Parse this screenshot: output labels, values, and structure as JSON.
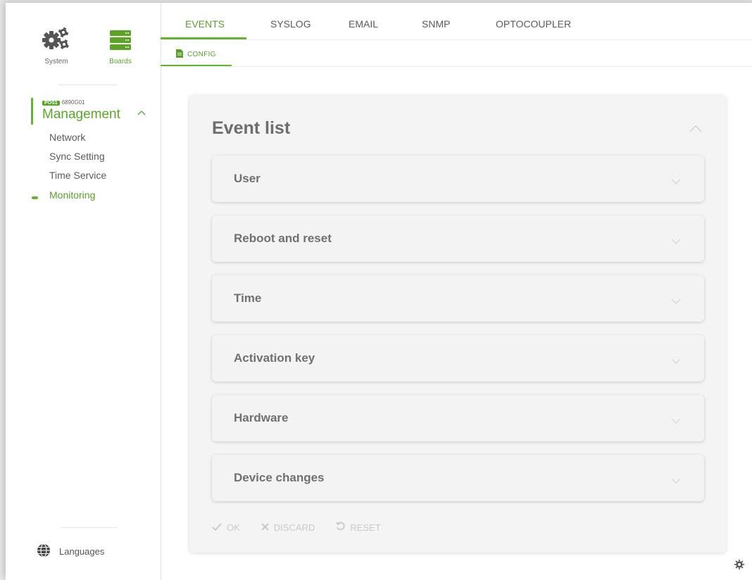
{
  "sidebar": {
    "top_icons": [
      {
        "label": "System",
        "icon": "gears-icon"
      },
      {
        "label": "Boards",
        "icon": "server-stack-icon"
      }
    ],
    "module": {
      "badge": "POS1",
      "model": "6890G01",
      "title": "Management"
    },
    "nav": [
      {
        "label": "Network",
        "active": false
      },
      {
        "label": "Sync Setting",
        "active": false
      },
      {
        "label": "Time Service",
        "active": false
      },
      {
        "label": "Monitoring",
        "active": true
      }
    ],
    "languages_label": "Languages"
  },
  "tabs": [
    {
      "label": "EVENTS",
      "active": true
    },
    {
      "label": "SYSLOG",
      "active": false
    },
    {
      "label": "EMAIL",
      "active": false
    },
    {
      "label": "SNMP",
      "active": false
    },
    {
      "label": "OPTOCOUPLER",
      "active": false
    }
  ],
  "subtab": {
    "label": "CONFIG",
    "icon": "document-icon"
  },
  "card": {
    "title": "Event list",
    "panels": [
      "User",
      "Reboot and reset",
      "Time",
      "Activation key",
      "Hardware",
      "Device changes"
    ]
  },
  "actions": {
    "ok": "OK",
    "discard": "DISCARD",
    "reset": "RESET"
  },
  "colors": {
    "accent": "#64b52e",
    "text": "#5a5a5a",
    "disabled": "#c9c9c9",
    "card_bg": "#f4f4f4"
  }
}
